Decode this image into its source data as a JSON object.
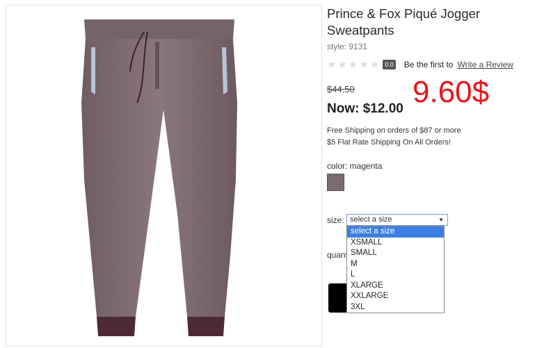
{
  "product": {
    "title": "Prince & Fox Piqué Jogger Sweatpants",
    "style": "style: 9131",
    "rating": {
      "stars": 5,
      "score": "0.0",
      "first": "Be the first to",
      "review_link": "Write a Review"
    },
    "was_price": "$44.50",
    "now_price": "Now: $12.00",
    "overlay_price": "9.60$",
    "shipping": [
      "Free Shipping on orders of $87 or more",
      "$5 Flat Rate Shipping On All Orders!"
    ],
    "color_label": "color: magenta",
    "size_label": "size:",
    "size_select": {
      "value": "select a size",
      "options": [
        "select a size",
        "XSMALL",
        "SMALL",
        "M",
        "L",
        "XLARGE",
        "XXLARGE",
        "3XL"
      ]
    },
    "quantity_label": "quantity"
  },
  "colors": {
    "overlay": "#e8141b",
    "selected_option": "#3d7fe0",
    "swatch": "#7b6a70"
  }
}
